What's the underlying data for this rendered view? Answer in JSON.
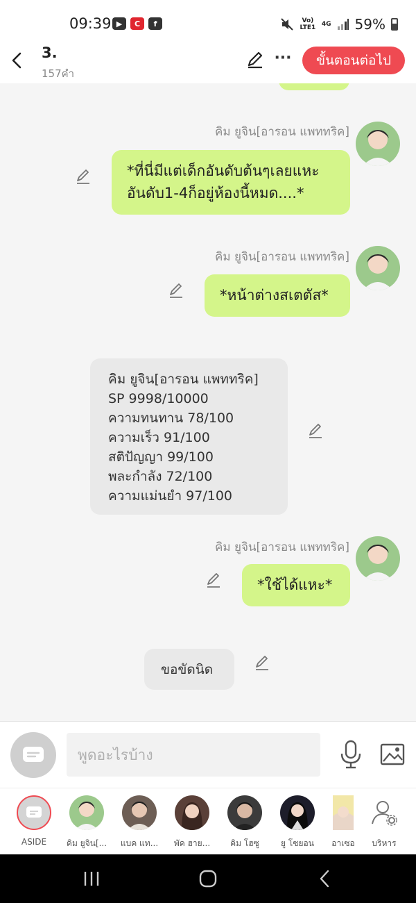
{
  "status_bar": {
    "time": "09:39",
    "app_badge_c": "C",
    "app_badge_f": "f",
    "network": "Vo) LTE1",
    "signal": "4G",
    "battery": "59%"
  },
  "header": {
    "title": "3.",
    "word_count": "157คำ",
    "next_step_label": "ขั้นตอนต่อไป",
    "more_label": "···",
    "accent_color": "#ef4a52"
  },
  "messages": [
    {
      "type": "user",
      "sender": "คิม ยูจิน[อารอน แพททริค]",
      "text": "*ที่นี่มีแต่เด็กอันดับต้นๆเลยแหะ\nอันดับ1-4ก็อยู่ห้องนี้หมด....*"
    },
    {
      "type": "user",
      "sender": "คิม ยูจิน[อารอน แพททริค]",
      "text": "*หน้าต่างสเตตัส*"
    },
    {
      "type": "system",
      "lines": [
        "คิม ยูจิน[อารอน แพททริค]",
        "SP 9998/10000",
        "ความทนทาน 78/100",
        "ความเร็ว 91/100",
        "สติปัญญา 99/100",
        "พละกำลัง 72/100",
        "ความแม่นยำ 97/100"
      ]
    },
    {
      "type": "user",
      "sender": "คิม ยูจิน[อารอน แพททริค]",
      "text": "*ใช้ได้แหะ*"
    },
    {
      "type": "narration",
      "text": "ขอขัดนิด"
    }
  ],
  "input": {
    "placeholder": "พูดอะไรบ้าง"
  },
  "characters": [
    {
      "name": "ASIDE"
    },
    {
      "name": "คิม ยูจิน[..."
    },
    {
      "name": "แบค แท..."
    },
    {
      "name": "พัค ฮาย..."
    },
    {
      "name": "คิม โฮซู"
    },
    {
      "name": "ยู โซยอน"
    },
    {
      "name": "อาเซอ"
    },
    {
      "name": "บริหาร"
    }
  ],
  "colors": {
    "user_bubble": "#d4f58a",
    "system_bubble": "#e9e9e9",
    "background": "#f5f5f5"
  }
}
